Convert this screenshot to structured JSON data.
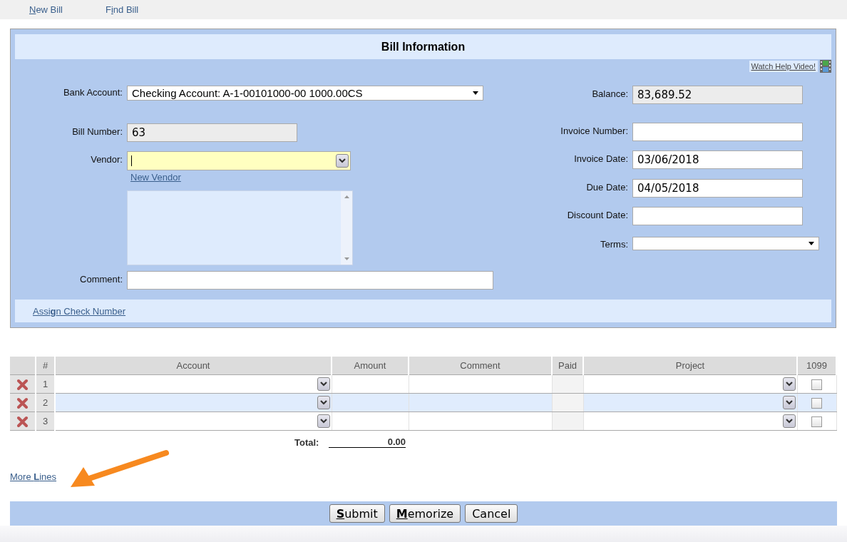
{
  "nav": [
    {
      "label": "**N**ew Bill"
    },
    {
      "label": "F**i**nd Bill"
    }
  ],
  "bill_info": {
    "title": "Bill Information",
    "help_link": "Watch Help Video!",
    "left_fields": [
      {
        "kind": "select",
        "label": "Bank Account:",
        "value": "Checking Account: A-1-00101000-00 1000.00CS",
        "readonly": false
      },
      {
        "kind": "text",
        "label": "Bill Number:",
        "value": "63",
        "readonly": true
      },
      {
        "kind": "combo",
        "label": "Vendor:",
        "focused": true,
        "readonly": false,
        "link": "New Vendor"
      },
      {
        "kind": "textarea",
        "readonly": false
      },
      {
        "kind": "text",
        "label": "Comment:",
        "readonly": false
      }
    ],
    "right_fields": [
      {
        "kind": "text",
        "label": "Balance:",
        "value": "83,689.52",
        "readonly": true
      },
      {
        "kind": "text",
        "label": "Invoice Number:",
        "readonly": false
      },
      {
        "kind": "text",
        "label": "Invoice Date:",
        "value": "03/06/2018",
        "readonly": false
      },
      {
        "kind": "text",
        "label": "Due Date:",
        "value": "04/05/2018",
        "readonly": false
      },
      {
        "kind": "text",
        "label": "Discount Date:",
        "readonly": false
      },
      {
        "kind": "select",
        "label": "Terms:",
        "readonly": false
      }
    ],
    "assign_link": "Assi**g**n Check Number"
  },
  "lines": {
    "columns": [
      "#",
      "Account",
      "Amount",
      "Comment",
      "Paid",
      "Project",
      "1099"
    ],
    "rows": [
      {
        "number": "1",
        "selected": false,
        "checked_1099": false
      },
      {
        "number": "2",
        "selected": true,
        "checked_1099": false
      },
      {
        "number": "3",
        "selected": false,
        "checked_1099": false
      }
    ],
    "total_label": "Total:",
    "total_value": "0.00"
  },
  "more_lines": "More **L**ines",
  "buttons": [
    "**S**ubmit",
    "**M**emorize",
    "Cancel"
  ]
}
